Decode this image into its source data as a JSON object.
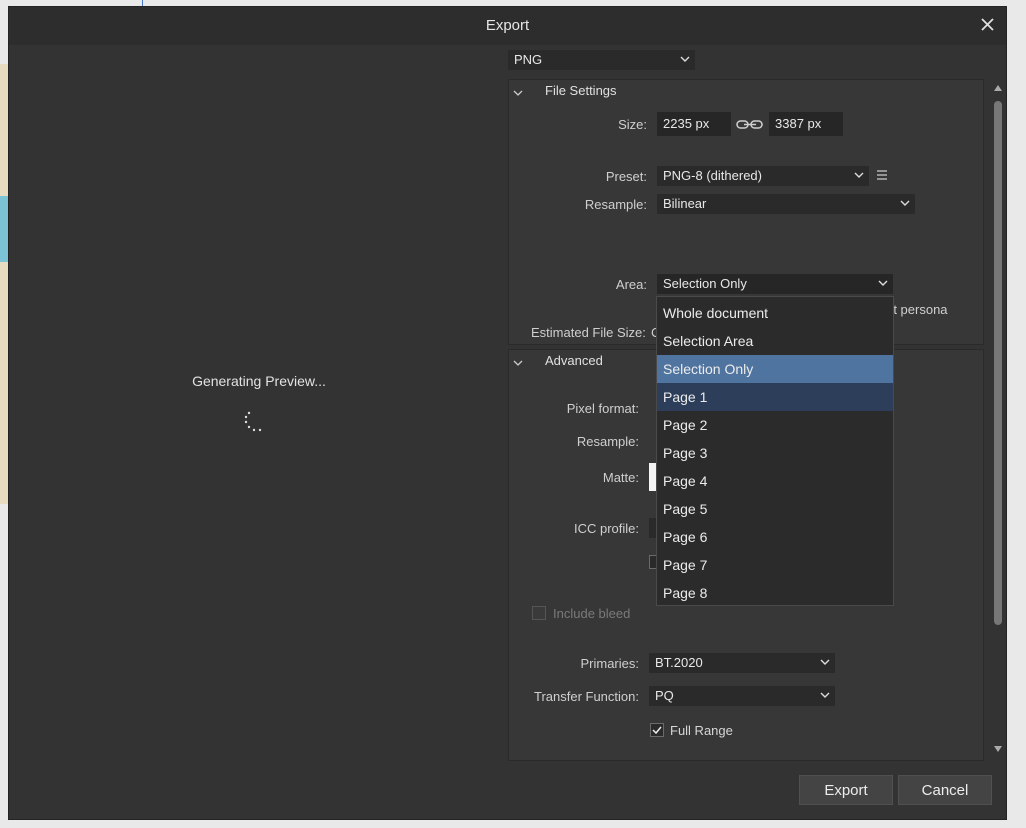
{
  "dialog": {
    "title": "Export"
  },
  "format": {
    "value": "PNG"
  },
  "preview": {
    "status": "Generating Preview..."
  },
  "file_settings": {
    "title": "File Settings",
    "size_label": "Size:",
    "width": "2235 px",
    "height": "3387 px",
    "preset_label": "Preset:",
    "preset": "PNG-8 (dithered)",
    "resample_label": "Resample:",
    "resample": "Bilinear",
    "area_label": "Area:",
    "area": "Selection Only",
    "behind_text": "rt persona",
    "estimated_label": "Estimated File Size:",
    "estimated_value": "C"
  },
  "advanced": {
    "title": "Advanced",
    "pixel_format_label": "Pixel format:",
    "resample_label": "Resample:",
    "matte_label": "Matte:",
    "icc_label": "ICC profile:",
    "include_bleed": "Include bleed",
    "primaries_label": "Primaries:",
    "primaries": "BT.2020",
    "transfer_label": "Transfer Function:",
    "transfer": "PQ",
    "full_range": "Full Range"
  },
  "area_dropdown": {
    "options": [
      "Whole document",
      "Selection Area",
      "Selection Only",
      "Page 1",
      "Page 2",
      "Page 3",
      "Page 4",
      "Page 5",
      "Page 6",
      "Page 7",
      "Page 8"
    ],
    "selected": "Selection Only",
    "hovered": "Page 1"
  },
  "buttons": {
    "export": "Export",
    "cancel": "Cancel"
  }
}
